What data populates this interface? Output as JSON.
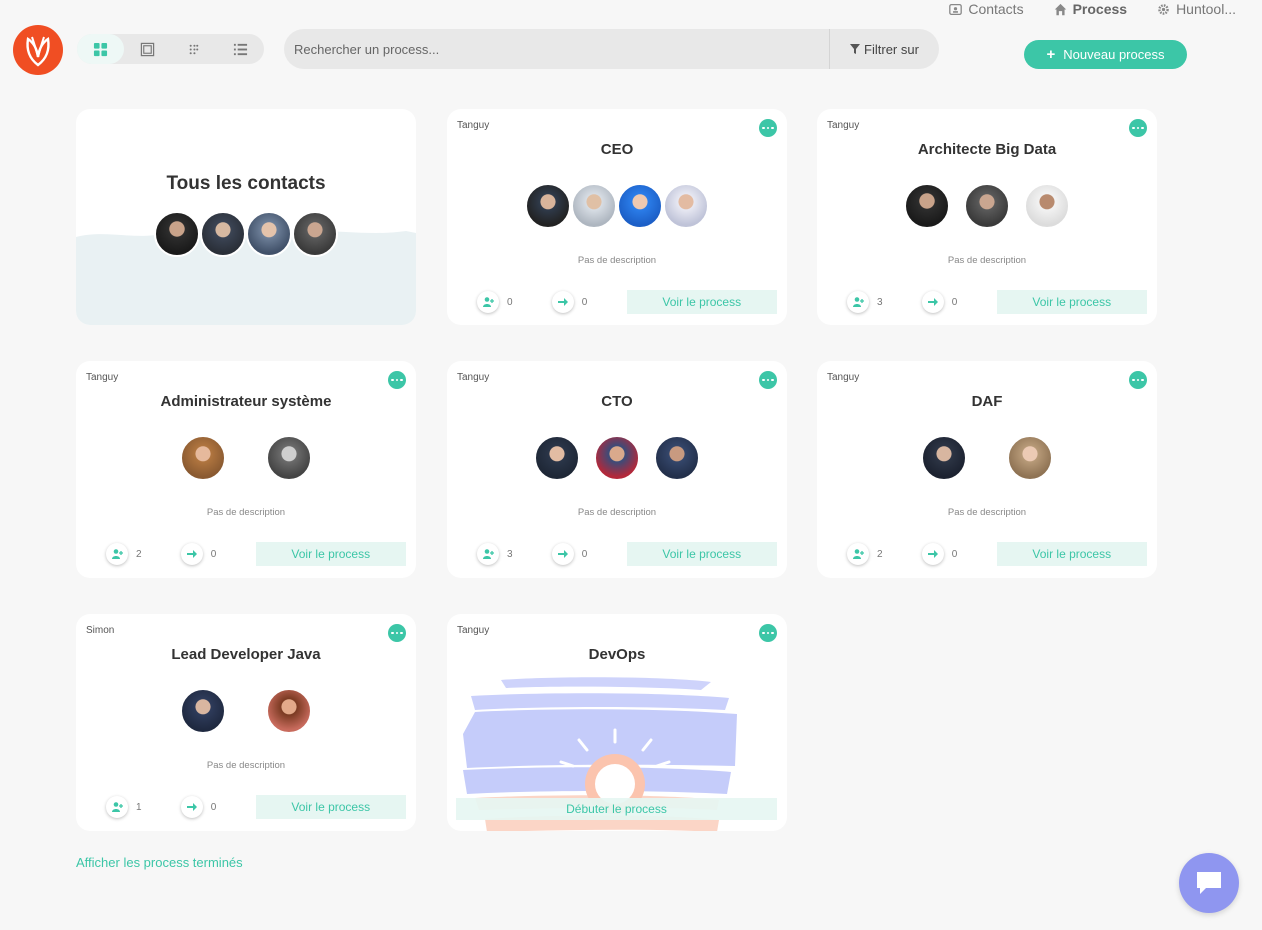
{
  "topnav": [
    {
      "label": "Contacts",
      "icon": "contacts-icon"
    },
    {
      "label": "Process",
      "icon": "home-icon"
    },
    {
      "label": "Huntool...",
      "icon": "gear-icon"
    }
  ],
  "search": {
    "placeholder": "Rechercher un process...",
    "filter_label": "Filtrer sur"
  },
  "new_button": "Nouveau process",
  "all_contacts": {
    "title": "Tous les contacts"
  },
  "cards": [
    {
      "owner": "Tanguy",
      "title": "CEO",
      "desc": "Pas de description",
      "candidates": "0",
      "steps": "0",
      "action": "Voir le process"
    },
    {
      "owner": "Tanguy",
      "title": "Architecte Big Data",
      "desc": "Pas de description",
      "candidates": "3",
      "steps": "0",
      "action": "Voir le process"
    },
    {
      "owner": "Tanguy",
      "title": "Administrateur système",
      "desc": "Pas de description",
      "candidates": "2",
      "steps": "0",
      "action": "Voir le process"
    },
    {
      "owner": "Tanguy",
      "title": "CTO",
      "desc": "Pas de description",
      "candidates": "3",
      "steps": "0",
      "action": "Voir le process"
    },
    {
      "owner": "Tanguy",
      "title": "DAF",
      "desc": "Pas de description",
      "candidates": "2",
      "steps": "0",
      "action": "Voir le process"
    },
    {
      "owner": "Simon",
      "title": "Lead Developer Java",
      "desc": "Pas de description",
      "candidates": "1",
      "steps": "0",
      "action": "Voir le process"
    },
    {
      "owner": "Tanguy",
      "title": "DevOps",
      "action": "Débuter le process"
    }
  ],
  "show_finished": "Afficher les process terminés",
  "colors": {
    "accent": "#3cc6a7",
    "logo": "#f04e23",
    "chat": "#8f96f0"
  }
}
